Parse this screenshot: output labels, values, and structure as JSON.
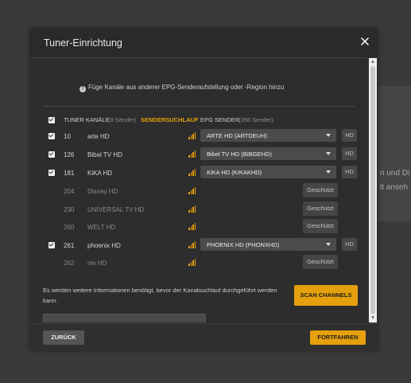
{
  "background": {
    "text_lines": [
      "n und Di",
      "lt anseh"
    ]
  },
  "dialog": {
    "title": "Tuner-Einrichtung",
    "hint": "Füge Kanäle aus anderer EPG-Senderaufstellung oder -Region hinzu",
    "header": {
      "tuner_label": "TUNER KANÄLE",
      "tuner_count": "(8 Sender)",
      "scan_label": "SENDERSUCHLAUF",
      "epg_label": "EPG SENDER",
      "epg_count": "(356 Sender)"
    },
    "rows": [
      {
        "num": "10",
        "name": "arte HD",
        "selected": "ARTE HD (ARTDEUH)",
        "hd": "HD"
      },
      {
        "num": "126",
        "name": "Bibel TV HD",
        "selected": "Bibel TV HD (BIBGEHD)",
        "hd": "HD"
      },
      {
        "num": "181",
        "name": "KiKA HD",
        "selected": "KiKA HD (KIKAKHD)",
        "hd": "HD"
      },
      {
        "num": "204",
        "name": "Disney HD",
        "protected": "Geschützt"
      },
      {
        "num": "230",
        "name": "UNIVERSAL TV HD",
        "protected": "Geschützt"
      },
      {
        "num": "260",
        "name": "WELT HD",
        "protected": "Geschützt"
      },
      {
        "num": "261",
        "name": "phoenix HD",
        "selected": "PHOENIX HD (PHONXHD)",
        "hd": "HD"
      },
      {
        "num": "262",
        "name": "ntv HD",
        "protected": "Geschützt"
      }
    ],
    "info_text": "Es werden weitere Informationen benötigt, bevor der Kanalsuchlauf durchgeführt werden kann.",
    "scan_button": "SCAN CHANNELS",
    "back_button": "ZURÜCK",
    "continue_button": "FORTFAHREN"
  },
  "colors": {
    "accent": "#e5a00d",
    "dialog_bg": "#2d2d2d",
    "select_bg": "#4b4b4b"
  },
  "icons": [
    "close-icon",
    "info-icon",
    "checkbox-icon",
    "signal-icon",
    "chevron-down-icon",
    "scroll-up-arrow",
    "scroll-down-arrow"
  ]
}
